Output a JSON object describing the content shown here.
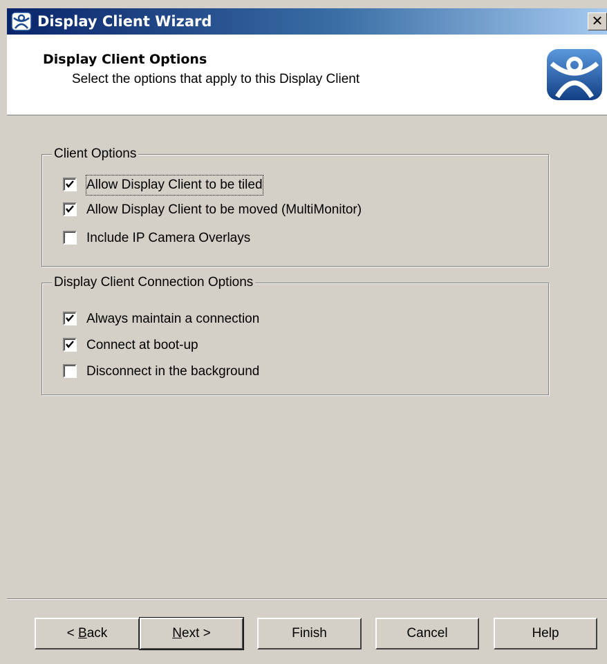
{
  "window": {
    "title": "Display Client Wizard",
    "close_label": "✕"
  },
  "header": {
    "title": "Display Client Options",
    "subtitle": "Select the options that apply to this Display Client",
    "logo_icon": "thinmanager-logo-icon"
  },
  "client_options": {
    "legend": "Client Options",
    "items": [
      {
        "label": "Allow Display Client to be tiled",
        "checked": true
      },
      {
        "label": "Allow Display Client to be moved (MultiMonitor)",
        "checked": true
      },
      {
        "label": "Include IP Camera Overlays",
        "checked": false
      }
    ]
  },
  "connection_options": {
    "legend": "Display Client Connection Options",
    "items": [
      {
        "label": "Always maintain a connection",
        "checked": true
      },
      {
        "label": "Connect at boot-up",
        "checked": true
      },
      {
        "label": "Disconnect in the background",
        "checked": false
      }
    ]
  },
  "buttons": {
    "back": {
      "accel": "B",
      "rest": "ack",
      "prefix": "< "
    },
    "next": {
      "accel": "N",
      "rest": "ext >"
    },
    "finish": "Finish",
    "cancel": "Cancel",
    "help": "Help"
  },
  "colors": {
    "face": "#d4d0c8",
    "title_start": "#0a246a",
    "logo_blue": "#1f63b5"
  }
}
